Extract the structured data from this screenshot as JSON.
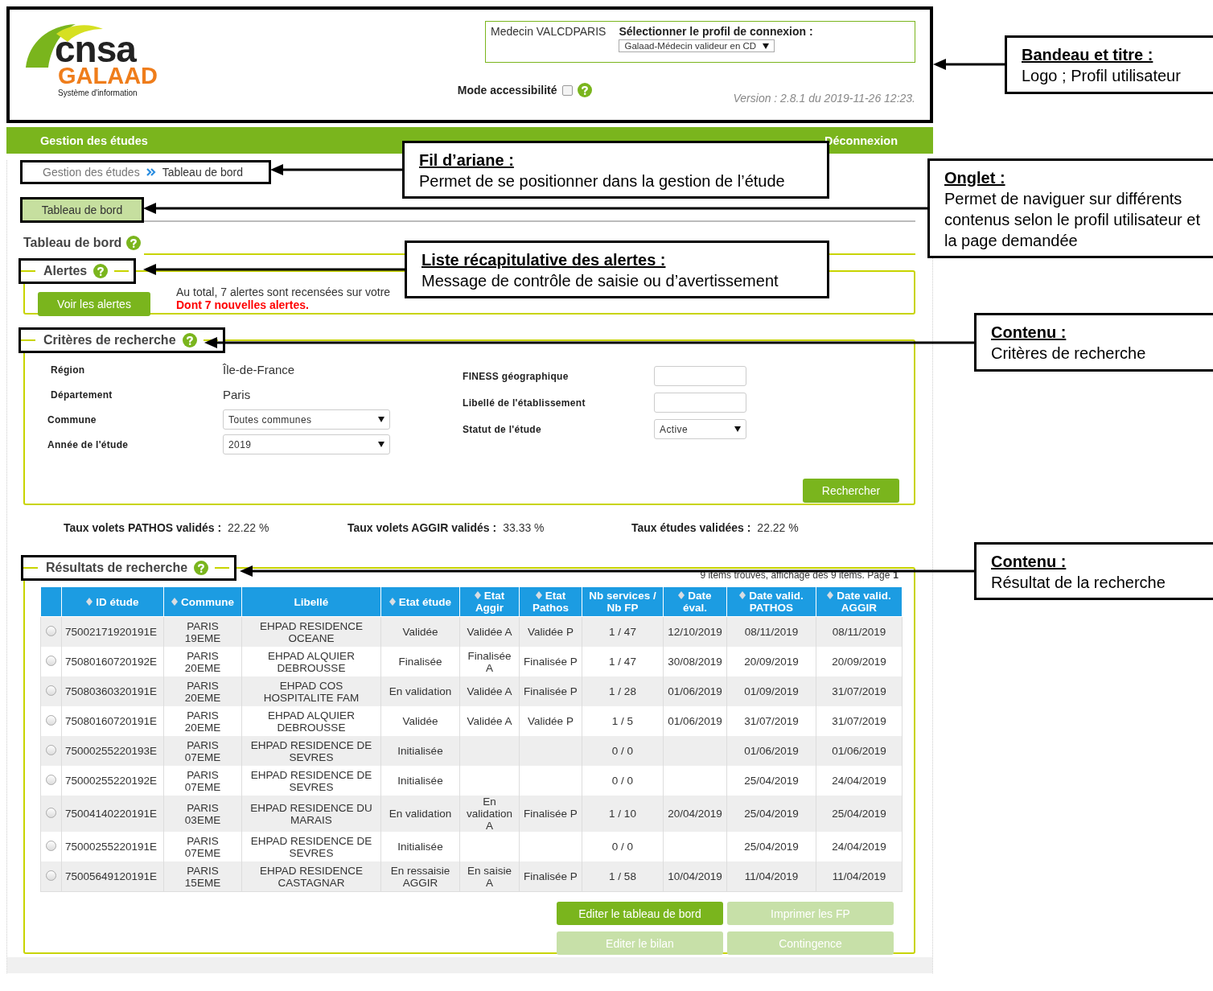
{
  "header": {
    "logo": {
      "brand": "cnsa",
      "product": "GALAAD",
      "tagline": "Système d'information"
    },
    "user": "Medecin VALCDPARIS",
    "profile_label": "Sélectionner le profil de connexion :",
    "profile_value": "Galaad-Médecin valideur en CD",
    "accessibility_label": "Mode accessibilité",
    "accessibility_checked": false,
    "version": "Version : 2.8.1 du 2019-11-26 12:23."
  },
  "nav": {
    "title": "Gestion des études",
    "logout": "Déconnexion"
  },
  "breadcrumb": [
    "Gestion des études",
    "Tableau de bord"
  ],
  "tabs": [
    {
      "label": "Tableau de bord",
      "selected": true
    }
  ],
  "page_title": "Tableau de bord",
  "alerts": {
    "legend": "Alertes",
    "button": "Voir les alertes",
    "message": "Au total, 7 alertes sont recensées sur votre",
    "highlight": "Dont 7 nouvelles alertes."
  },
  "criteria": {
    "legend": "Critères de recherche",
    "left": [
      {
        "label": "Région",
        "kind": "text",
        "value": "Île-de-France"
      },
      {
        "label": "Département",
        "kind": "text",
        "value": "Paris"
      },
      {
        "label": "Commune",
        "kind": "select",
        "value": "Toutes communes"
      },
      {
        "label": "Année de l'étude",
        "kind": "select",
        "value": "2019"
      }
    ],
    "right": [
      {
        "label": "FINESS géographique",
        "kind": "input"
      },
      {
        "label": "Libellé de l'établissement",
        "kind": "input"
      },
      {
        "label": "Statut de l'étude",
        "kind": "select",
        "value": "Active"
      }
    ],
    "button": "Rechercher"
  },
  "rates": [
    {
      "label": "Taux volets PATHOS validés :",
      "value": "22.22 %"
    },
    {
      "label": "Taux volets AGGIR validés :",
      "value": "33.33 %"
    },
    {
      "label": "Taux études validées :",
      "value": "22.22 %"
    }
  ],
  "results": {
    "legend": "Résultats de recherche",
    "summary": "9 items trouvés, affichage des 9 items. Page",
    "page": "1",
    "columns": [
      {
        "label": "ID étude",
        "sortable": true
      },
      {
        "label": "Commune",
        "sortable": true
      },
      {
        "label": "Libellé",
        "sortable": false
      },
      {
        "label": "Etat étude",
        "sortable": true
      },
      {
        "label": "Etat\nAggir",
        "sortable": true
      },
      {
        "label": "Etat\nPathos",
        "sortable": true
      },
      {
        "label": "Nb services /\nNb FP",
        "sortable": false
      },
      {
        "label": "Date\néval.",
        "sortable": true
      },
      {
        "label": "Date valid.\nPATHOS",
        "sortable": true
      },
      {
        "label": "Date valid.\nAGGIR",
        "sortable": true
      }
    ],
    "rows": [
      {
        "selected": false,
        "cells": [
          "75002171920191E",
          "PARIS\n19EME",
          "EHPAD RESIDENCE\nOCEANE",
          "Validée",
          "Validée A",
          "Validée P",
          "1 / 47",
          "12/10/2019",
          "08/11/2019",
          "08/11/2019"
        ]
      },
      {
        "selected": false,
        "cells": [
          "75080160720192E",
          "PARIS\n20EME",
          "EHPAD ALQUIER\nDEBROUSSE",
          "Finalisée",
          "Finalisée\nA",
          "Finalisée P",
          "1 / 47",
          "30/08/2019",
          "20/09/2019",
          "20/09/2019"
        ]
      },
      {
        "selected": false,
        "cells": [
          "75080360320191E",
          "PARIS\n20EME",
          "EHPAD COS\nHOSPITALITE FAM",
          "En validation",
          "Validée A",
          "Finalisée P",
          "1 / 28",
          "01/06/2019",
          "01/09/2019",
          "31/07/2019"
        ]
      },
      {
        "selected": false,
        "cells": [
          "75080160720191E",
          "PARIS\n20EME",
          "EHPAD ALQUIER\nDEBROUSSE",
          "Validée",
          "Validée A",
          "Validée P",
          "1 / 5",
          "01/06/2019",
          "31/07/2019",
          "31/07/2019"
        ]
      },
      {
        "selected": false,
        "cells": [
          "75000255220193E",
          "PARIS\n07EME",
          "EHPAD RESIDENCE DE\nSEVRES",
          "Initialisée",
          null,
          null,
          "0 / 0",
          null,
          "01/06/2019",
          "01/06/2019"
        ]
      },
      {
        "selected": false,
        "cells": [
          "75000255220192E",
          "PARIS\n07EME",
          "EHPAD RESIDENCE DE\nSEVRES",
          "Initialisée",
          null,
          null,
          "0 / 0",
          null,
          "25/04/2019",
          "24/04/2019"
        ]
      },
      {
        "selected": false,
        "cells": [
          "75004140220191E",
          "PARIS\n03EME",
          "EHPAD RESIDENCE DU\nMARAIS",
          "En validation",
          "En\nvalidation\nA",
          "Finalisée P",
          "1 / 10",
          "20/04/2019",
          "25/04/2019",
          "25/04/2019"
        ]
      },
      {
        "selected": false,
        "cells": [
          "75000255220191E",
          "PARIS\n07EME",
          "EHPAD RESIDENCE DE\nSEVRES",
          "Initialisée",
          null,
          null,
          "0 / 0",
          null,
          "25/04/2019",
          "24/04/2019"
        ]
      },
      {
        "selected": false,
        "cells": [
          "75005649120191E",
          "PARIS\n15EME",
          "EHPAD RESIDENCE\nCASTAGNAR",
          "En ressaisie\nAGGIR",
          "En saisie\nA",
          "Finalisée P",
          "1 / 58",
          "10/04/2019",
          "11/04/2019",
          "11/04/2019"
        ]
      }
    ],
    "buttons": [
      {
        "label": "Editer le tableau de bord",
        "disabled": false
      },
      {
        "label": "Imprimer les FP",
        "disabled": true
      },
      {
        "label": "Editer le bilan",
        "disabled": true
      },
      {
        "label": "Contingence",
        "disabled": true
      }
    ]
  },
  "annotations": [
    {
      "title": "Bandeau et titre :",
      "text": "Logo ; Profil utilisateur"
    },
    {
      "title": "Fil d’ariane :",
      "text": "Permet de se positionner dans la gestion de l’étude"
    },
    {
      "title": "Onglet :",
      "text": "Permet de naviguer sur différents contenus selon le profil utilisateur et la page demandée"
    },
    {
      "title": "Liste récapitulative des alertes :",
      "text": "Message de contrôle de saisie ou d’avertissement"
    },
    {
      "title": "Contenu :",
      "text": "Critères de recherche"
    },
    {
      "title": "Contenu :",
      "text": "Résultat de la recherche"
    }
  ]
}
